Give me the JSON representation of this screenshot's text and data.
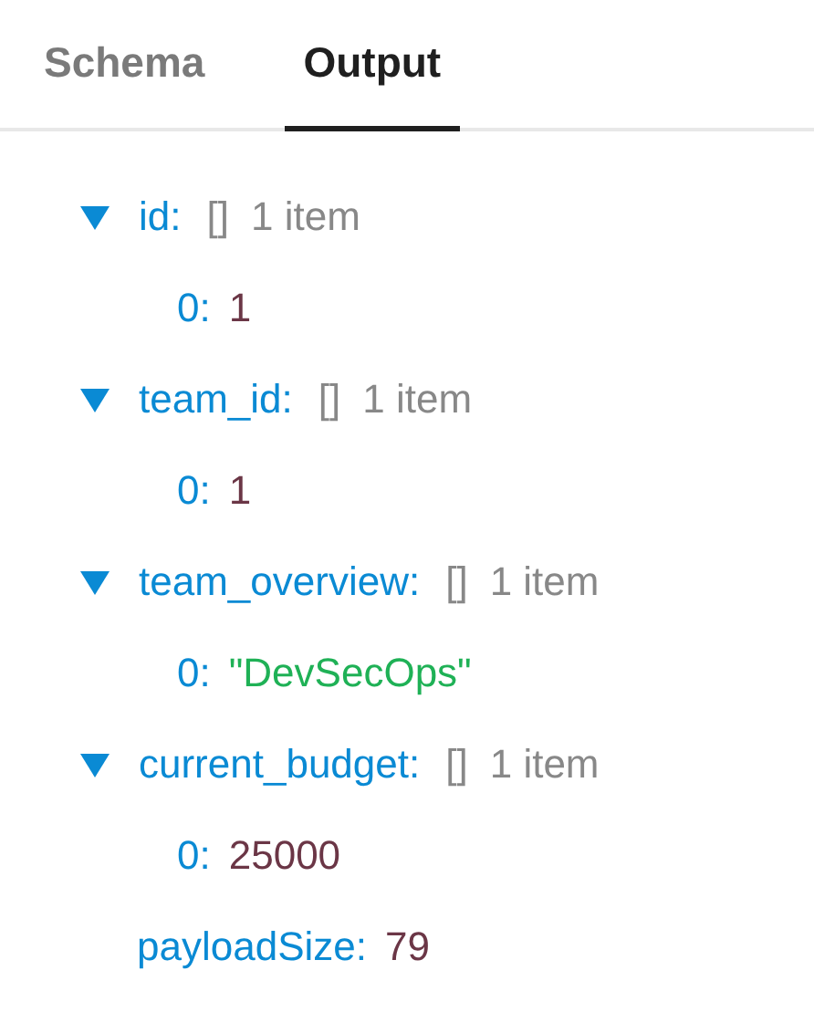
{
  "tabs": [
    {
      "label": "Schema",
      "selected": false
    },
    {
      "label": "Output",
      "selected": true
    }
  ],
  "tree": [
    {
      "key": "id:",
      "type_label": "[]",
      "count": "1 item",
      "expanded": true,
      "children": [
        {
          "key": "0:",
          "value": "1",
          "kind": "number"
        }
      ]
    },
    {
      "key": "team_id:",
      "type_label": "[]",
      "count": "1 item",
      "expanded": true,
      "children": [
        {
          "key": "0:",
          "value": "1",
          "kind": "number"
        }
      ]
    },
    {
      "key": "team_overview:",
      "type_label": "[]",
      "count": "1 item",
      "expanded": true,
      "children": [
        {
          "key": "0:",
          "value": "\"DevSecOps\"",
          "kind": "string"
        }
      ]
    },
    {
      "key": "current_budget:",
      "type_label": "[]",
      "count": "1 item",
      "expanded": true,
      "children": [
        {
          "key": "0:",
          "value": "25000",
          "kind": "number"
        }
      ]
    },
    {
      "key": "payloadSize:",
      "value": "79",
      "kind": "number"
    }
  ]
}
